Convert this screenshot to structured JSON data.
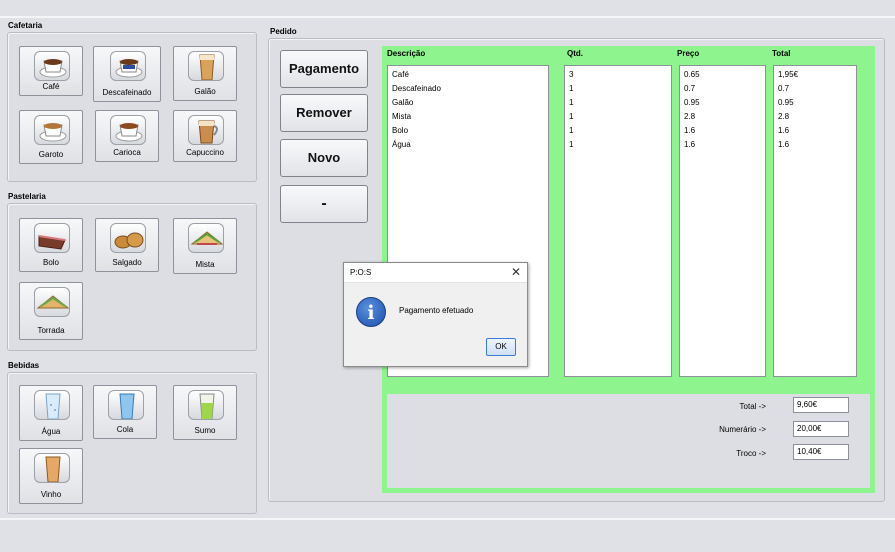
{
  "sections": {
    "cafetaria": "Cafetaria",
    "pastelaria": "Pastelaria",
    "bebidas": "Bebidas",
    "pedido": "Pedido"
  },
  "cafetaria": [
    "Café",
    "Descafeinado",
    "Galão",
    "Garoto",
    "Carioca",
    "Capuccino"
  ],
  "pastelaria": [
    "Bolo",
    "Salgado",
    "Mista",
    "Torrada"
  ],
  "bebidas": [
    "Água",
    "Cola",
    "Sumo",
    "Vinho"
  ],
  "actions": {
    "pagamento": "Pagamento",
    "remover": "Remover",
    "novo": "Novo",
    "minus": "-"
  },
  "order": {
    "headers": [
      "Descrição",
      "Qtd.",
      "Preço",
      "Total"
    ],
    "descricao": [
      "Café",
      "Descafeinado",
      "Galão",
      "Mista",
      "Bolo",
      "Água"
    ],
    "qtd": [
      "3",
      "1",
      "1",
      "1",
      "1",
      "1"
    ],
    "preco": [
      "0.65",
      "0.7",
      "0.95",
      "2.8",
      "1.6",
      "1.6"
    ],
    "total": [
      "1,95€",
      "0.7",
      "0.95",
      "2.8",
      "1.6",
      "1.6"
    ]
  },
  "totals": {
    "total_label": "Total ->",
    "total_value": "9,60€",
    "numerario_label": "Numerário ->",
    "numerario_value": "20,00€",
    "troco_label": "Troco ->",
    "troco_value": "10,40€"
  },
  "dialog": {
    "title": "P:O:S",
    "close": "✕",
    "icon": "i",
    "message": "Pagamento efetuado",
    "ok": "OK"
  },
  "colors": {
    "highlight_green": "#8ef58e",
    "dialog_info_blue": "#1c4fa8"
  }
}
